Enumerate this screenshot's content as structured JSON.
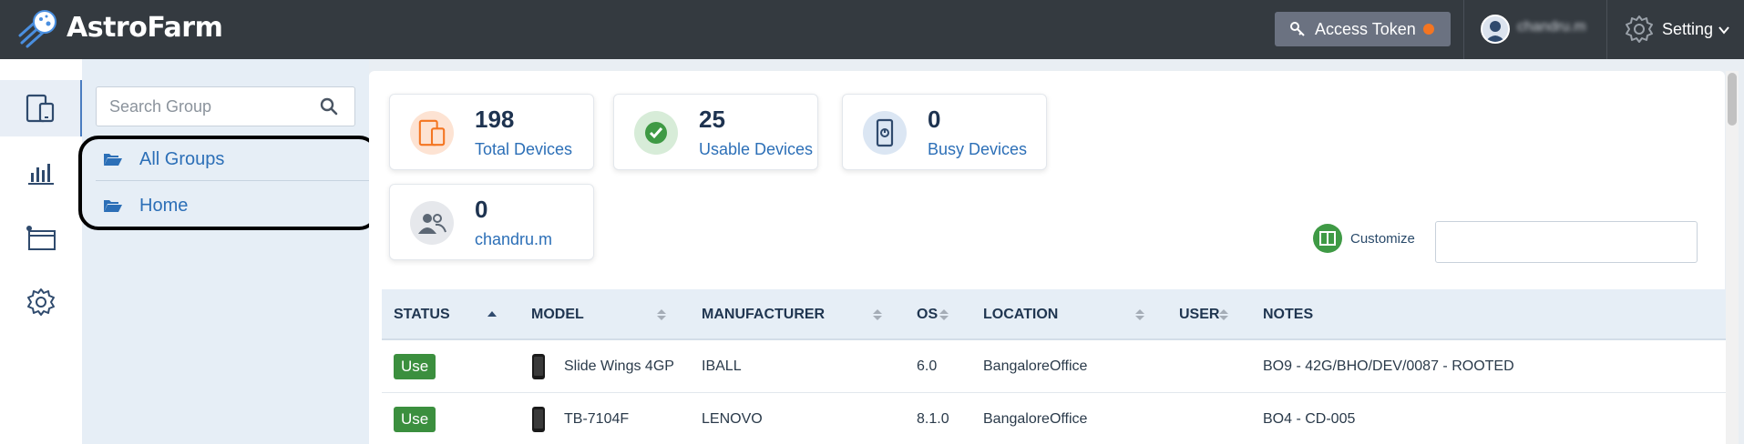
{
  "app": {
    "title": "AstroFarm"
  },
  "header": {
    "access_token_label": "Access Token",
    "username": "chandru.m",
    "setting_label": "Setting"
  },
  "colors": {
    "accent": "#2c6fb7",
    "status_green": "#3b8f3e",
    "token_dot": "#f47521",
    "topbar": "#343a40"
  },
  "rail": {
    "items": [
      {
        "icon": "devices-icon",
        "active": true
      },
      {
        "icon": "bar-chart-icon",
        "active": false
      },
      {
        "icon": "browser-window-icon",
        "active": false
      },
      {
        "icon": "gear-icon",
        "active": false
      }
    ]
  },
  "groups": {
    "search_placeholder": "Search Group",
    "items": [
      {
        "label": "All Groups"
      },
      {
        "label": "Home"
      }
    ]
  },
  "stats": [
    {
      "value": "198",
      "label": "Total Devices",
      "icon": "devices-icon"
    },
    {
      "value": "25",
      "label": "Usable Devices",
      "icon": "check-icon"
    },
    {
      "value": "0",
      "label": "Busy Devices",
      "icon": "phone-timer-icon"
    },
    {
      "value": "0",
      "label": "chandru.m",
      "icon": "users-icon"
    }
  ],
  "toolbar": {
    "customize_label": "Customize",
    "filter_value": ""
  },
  "table": {
    "columns": [
      "STATUS",
      "MODEL",
      "MANUFACTURER",
      "OS",
      "LOCATION",
      "USER",
      "NOTES"
    ],
    "rows": [
      {
        "status": "Use",
        "model": "Slide Wings 4GP",
        "manufacturer": "IBALL",
        "os": "6.0",
        "location": "BangaloreOffice",
        "user": "",
        "notes": "BO9 - 42G/BHO/DEV/0087 - ROOTED"
      },
      {
        "status": "Use",
        "model": "TB-7104F",
        "manufacturer": "LENOVO",
        "os": "8.1.0",
        "location": "BangaloreOffice",
        "user": "",
        "notes": "BO4 - CD-005"
      }
    ]
  }
}
